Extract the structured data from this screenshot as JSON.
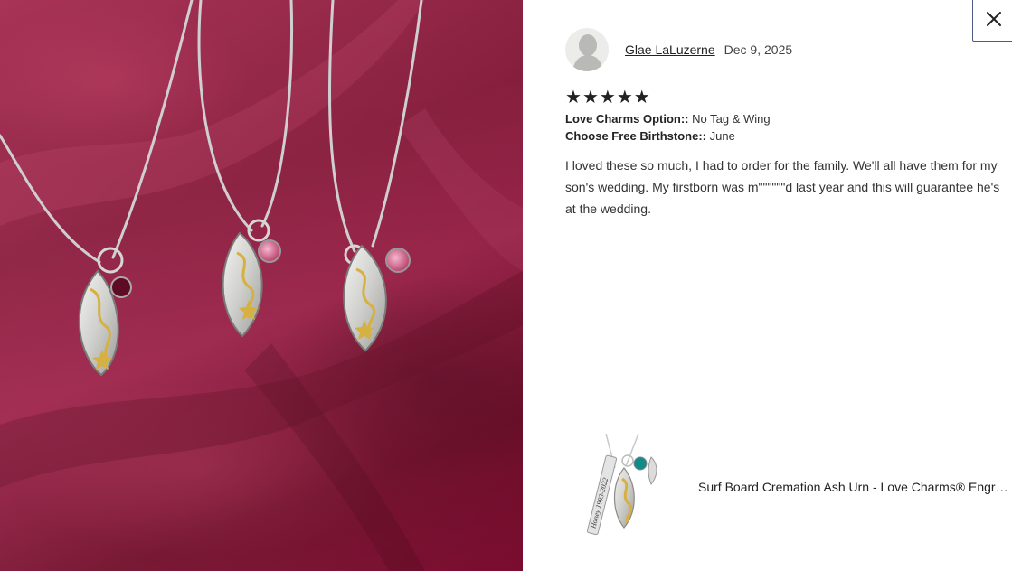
{
  "close": {
    "icon": "close-icon"
  },
  "reviewer": {
    "name": "Glae LaLuzerne",
    "date": "Dec 9, 2025",
    "avatar_icon": "person-silhouette-icon"
  },
  "rating": {
    "value": 5,
    "max": 5,
    "star_glyph": "★",
    "icon": "star-icon"
  },
  "options": [
    {
      "label": "Love Charms Option::",
      "value": "No Tag & Wing"
    },
    {
      "label": "Choose Free Birthstone::",
      "value": "June"
    }
  ],
  "review_text": "I loved these so much, I had to order for the family. We'll all have them for my son's wedding. My firstborn was m\"\"\"\"\"\"d last year and this will guarantee he's at the wedding.",
  "product": {
    "title": "Surf Board Cremation Ash Urn - Love Charms® Engraved Pendant",
    "thumb_engraving": "Honey 1993-2022"
  },
  "colors": {
    "fabric": "#8a1034",
    "pendant_silver": "#d8d8d6",
    "pendant_gold": "#d6b040",
    "birthstone_pink": "#d86a96",
    "thumb_stone": "#138a8a",
    "close_border": "#4a5c86"
  }
}
